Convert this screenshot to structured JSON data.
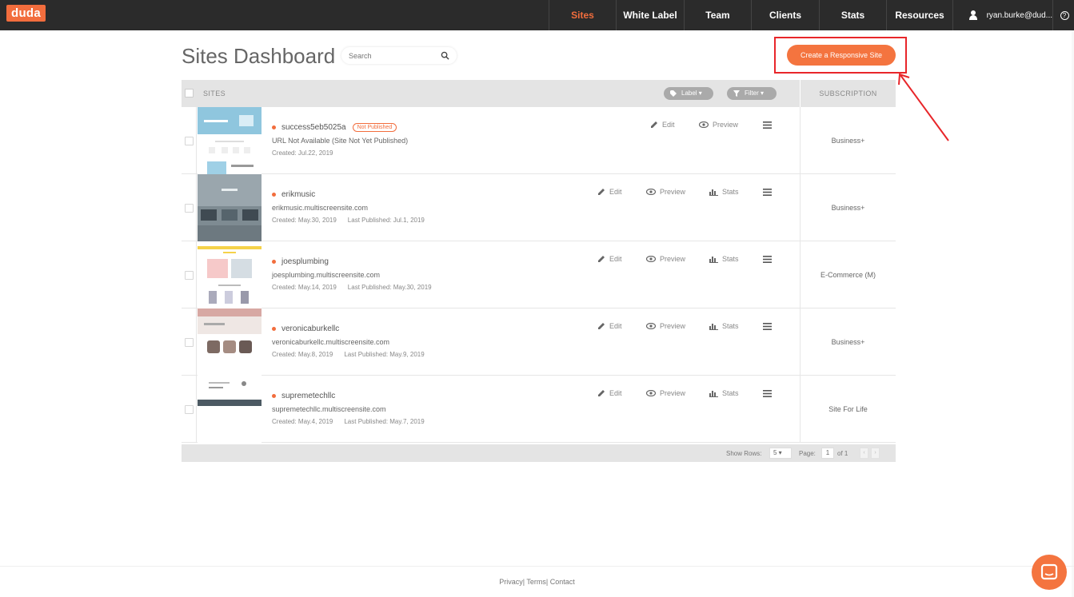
{
  "app": {
    "logo": "duda"
  },
  "nav": {
    "items": [
      {
        "label": "Sites",
        "active": true
      },
      {
        "label": "White Label"
      },
      {
        "label": "Team"
      },
      {
        "label": "Clients"
      },
      {
        "label": "Stats"
      },
      {
        "label": "Resources"
      }
    ],
    "user": "ryan.burke@dud...",
    "help": "?"
  },
  "header": {
    "title": "Sites Dashboard",
    "search_placeholder": "Search",
    "create_button": "Create a Responsive Site"
  },
  "table": {
    "col_sites": "SITES",
    "label_filter": "Label",
    "filter": "Filter",
    "col_subscription": "SUBSCRIPTION",
    "actions": {
      "edit": "Edit",
      "preview": "Preview",
      "stats": "Stats"
    },
    "rows": [
      {
        "name": "success5eb5025a",
        "badge": "Not Published",
        "url": "URL Not Available (Site Not Yet Published)",
        "created": "Created: Jul.22, 2019",
        "published": "",
        "subscription": "Business+"
      },
      {
        "name": "erikmusic",
        "badge": "",
        "url": "erikmusic.multiscreensite.com",
        "created": "Created: May.30, 2019",
        "published": "Last Published: Jul.1, 2019",
        "subscription": "Business+"
      },
      {
        "name": "joesplumbing",
        "badge": "",
        "url": "joesplumbing.multiscreensite.com",
        "created": "Created: May.14, 2019",
        "published": "Last Published: May.30, 2019",
        "subscription": "E-Commerce (M)"
      },
      {
        "name": "veronicaburkellc",
        "badge": "",
        "url": "veronicaburkellc.multiscreensite.com",
        "created": "Created: May.8, 2019",
        "published": "Last Published: May.9, 2019",
        "subscription": "Business+"
      },
      {
        "name": "supremetechllc",
        "badge": "",
        "url": "supremetechllc.multiscreensite.com",
        "created": "Created: May.4, 2019",
        "published": "Last Published: May.7, 2019",
        "subscription": "Site For Life"
      }
    ],
    "footer": {
      "show_rows_label": "Show Rows:",
      "rows_value": "5",
      "page_label": "Page:",
      "page_value": "1",
      "of_label": "of 1"
    }
  },
  "footer": {
    "privacy": "Privacy",
    "terms": "Terms",
    "contact": "Contact"
  },
  "colors": {
    "accent": "#f26d3d",
    "highlight": "#e8262a",
    "navbar": "#2b2b2b"
  }
}
